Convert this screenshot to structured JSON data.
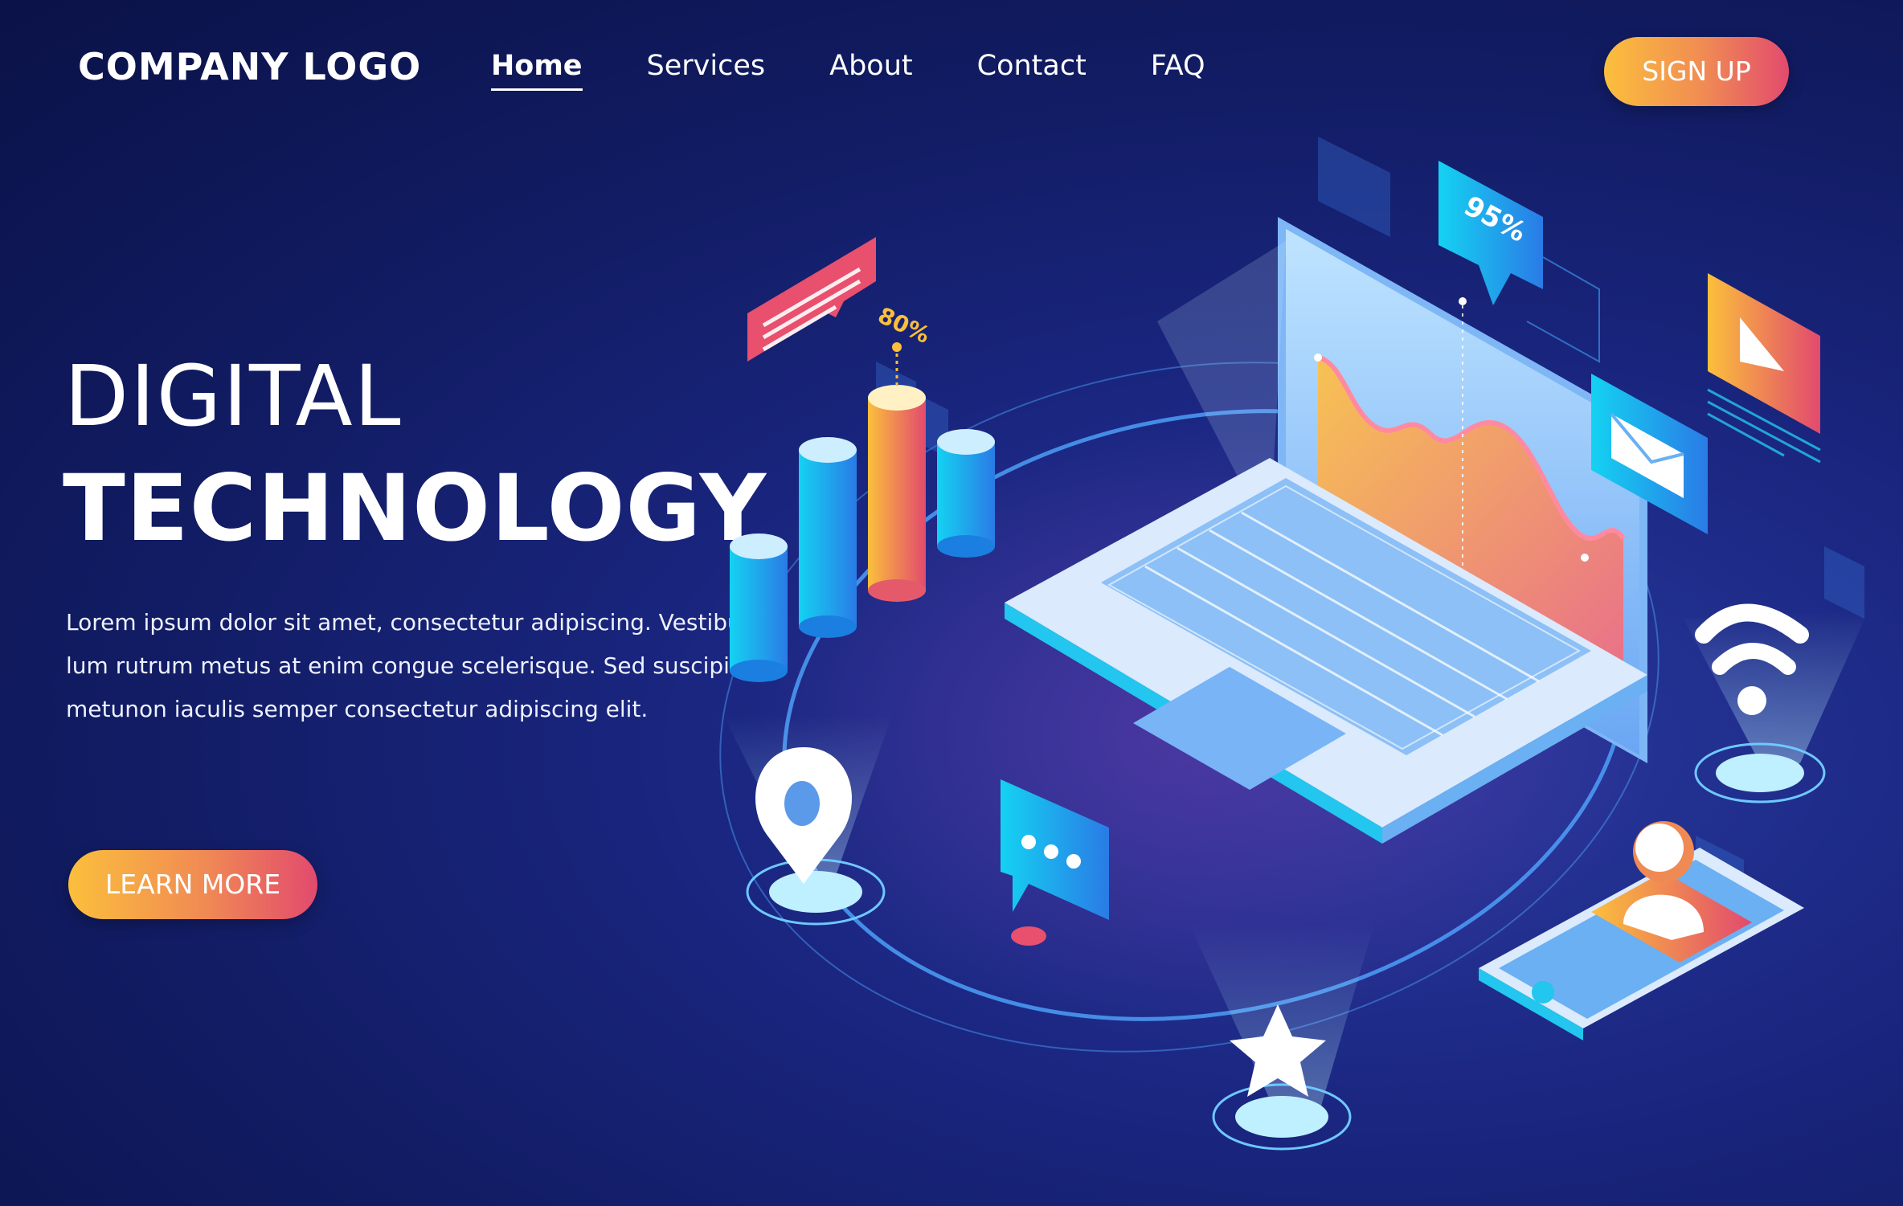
{
  "header": {
    "logo": "COMPANY LOGO",
    "nav": [
      {
        "label": "Home",
        "active": true
      },
      {
        "label": "Services",
        "active": false
      },
      {
        "label": "About",
        "active": false
      },
      {
        "label": "Contact",
        "active": false
      },
      {
        "label": "FAQ",
        "active": false
      }
    ],
    "signup_label": "SIGN UP"
  },
  "hero": {
    "title_line1": "DIGITAL",
    "title_line2": "TECHNOLOGY",
    "description": "Lorem ipsum dolor sit amet, consectetur adipiscing. Vestibu-lum rutrum metus at enim congue scelerisque. Sed suscipit metunon iaculis semper consectetur adipiscing elit.",
    "learn_more_label": "LEARN MORE"
  },
  "illustration": {
    "bubble_percent": "95%",
    "bar_percent": "80%",
    "icons": [
      "laptop-icon",
      "bar-chart-icon",
      "area-chart-icon",
      "mail-icon",
      "play-icon",
      "wifi-icon",
      "location-pin-icon",
      "chat-icon",
      "star-icon",
      "tablet-icon",
      "user-icon"
    ]
  },
  "colors": {
    "background": "#101a5e",
    "accent_start": "#fbbf3c",
    "accent_end": "#e24a6e",
    "cyan": "#22c6ee"
  }
}
